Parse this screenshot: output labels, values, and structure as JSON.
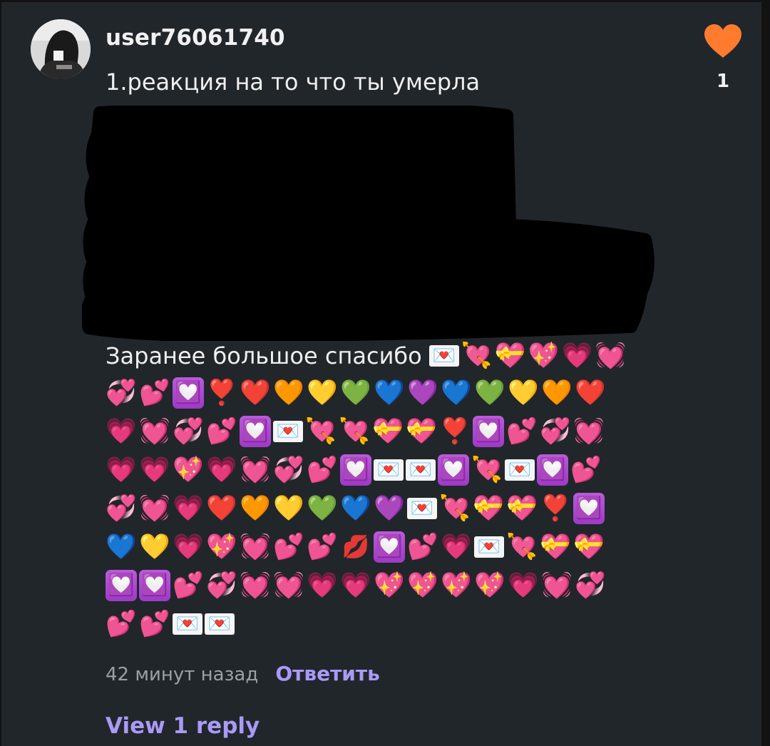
{
  "comment": {
    "username": "user76061740",
    "text": "1.реакция на то что ты умерла",
    "thanks_text": "Заранее большое спасибо",
    "likes": "1",
    "timestamp": "42 минут назад",
    "reply_label": "Ответить"
  },
  "replies": {
    "view_label": "View 1 reply"
  },
  "colors": {
    "background": "#21262b",
    "like_heart": "#ff7b2d",
    "link": "#a99af6",
    "redaction": "#000000"
  },
  "emoji_rows": [
    [
      "💌",
      "💘",
      "💝",
      "💖",
      "💗",
      "💓"
    ],
    [
      "💞",
      "💕",
      "💟",
      "❣️",
      "❤️",
      "🧡",
      "💛",
      "💚",
      "💙",
      "💜",
      "💙",
      "💚",
      "💛",
      "🧡",
      "❤️"
    ],
    [
      "💗",
      "💓",
      "💞",
      "💕",
      "💟",
      "💌",
      "💘",
      "💘",
      "💝",
      "💝",
      "❣️",
      "💟",
      "💕",
      "💞",
      "💓"
    ],
    [
      "💗",
      "💗",
      "💖",
      "💗",
      "💓",
      "💞",
      "💕",
      "💟",
      "💌",
      "💌",
      "💟",
      "💘",
      "💌",
      "💟",
      "💕"
    ],
    [
      "💞",
      "💓",
      "💗",
      "❤️",
      "🧡",
      "💛",
      "💚",
      "💙",
      "💜",
      "💌",
      "💘",
      "💝",
      "💝",
      "❣️",
      "💟"
    ],
    [
      "💙",
      "💛",
      "💗",
      "💖",
      "💓",
      "💕",
      "💕",
      "💋",
      "💟",
      "💕",
      "💗",
      "💌",
      "💘",
      "💝",
      "💝"
    ],
    [
      "💟",
      "💟",
      "💕",
      "💞",
      "💓",
      "💓",
      "💗",
      "💗",
      "💖",
      "💖",
      "💖",
      "💖",
      "💗",
      "💓",
      "💞"
    ],
    [
      "💕",
      "💕",
      "💌",
      "💌"
    ]
  ]
}
